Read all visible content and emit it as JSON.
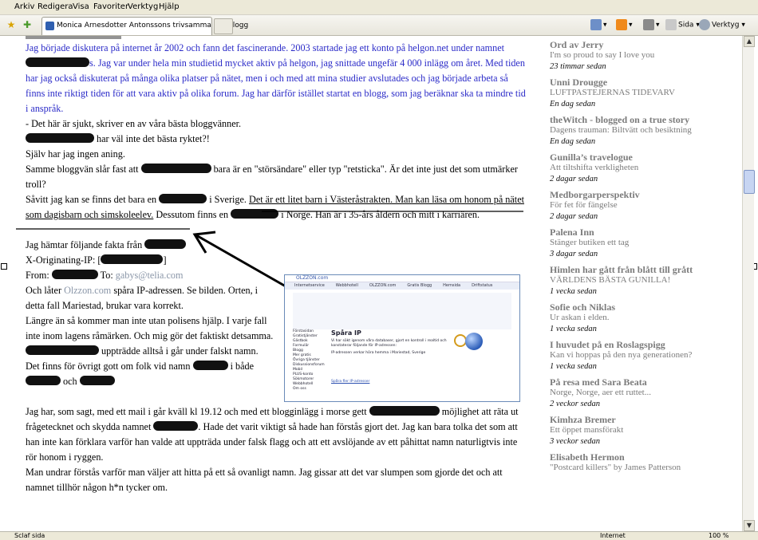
{
  "menu": [
    "Arkiv",
    "Redigera",
    "Visa",
    "Favoriter",
    "Verktyg",
    "Hjälp"
  ],
  "tab": {
    "title": "Monica Arnesdotter Antonssons trivsamma lilla blogg"
  },
  "toolbar": {
    "page_label": "Sida",
    "tools_label": "Verktyg"
  },
  "post": {
    "blue_1": "Jag började diskutera på internet år 2002 och fann det fascinerande. 2003 startade jag ett konto på helgon.net under namnet",
    "blue_2": "s. Jag var under hela min studietid mycket aktiv på helgon, jag snittade ungefär 4 000 inlägg om året. Med tiden har jag också diskuterat på många olika platser på nätet, men i och med att mina studier avslutades och jag började arbeta så finns inte riktigt tiden för att vara aktiv på olika forum. Jag har därför istället startat en blogg, som jag beräknar ska ta mindre tid i anspråk.",
    "l1": "- Det här är sjukt, skriver en av våra bästa bloggvänner.",
    "l2": "har väl inte det bästa ryktet?!",
    "l3": "Själv har jag ingen aning.",
    "l4a": "Samme bloggvän slår fast att",
    "l4b": "bara är en \"störsändare\" eller typ \"retsticka\". Är det inte just det som utmärker troll?",
    "l5a": "Såvitt jag kan se finns det bara en",
    "l5b": "i Sverige.",
    "l5c": "Det är ett litet barn i Västeråstrakten. Man kan läsa om honom på nätet som dagisbarn och simskoleelev.",
    "l5d": "Dessutom finns en",
    "l5e": "i Norge. Han är i 35-års åldern och mitt i karriären.",
    "l6": "Jag hämtar följande fakta från",
    "l7": "X-Originating-IP: [",
    "l7b": "]",
    "l8a": "From:",
    "l8b": "To:",
    "email": "gabys@telia.com",
    "l9a": "Och låter",
    "olzzon": "Olzzon.com",
    "l9b": "spåra IP-adressen. Se bilden. Orten, i detta fall Mariestad, brukar vara korrekt.",
    "l10": "Längre än så kommer man inte utan polisens hjälp. I varje fall inte inom lagens råmärken. Och mig gör det faktiskt detsamma.",
    "l11": "uppträdde alltså i går under falskt namn.",
    "l12a": "Det finns för övrigt gott om folk vid namn",
    "l12b": "i både",
    "l12c": "och",
    "l13a": "Jag har, som sagt, med ett mail i går kväll kl 19.12 och med ett blogginlägg i morse gett",
    "l13b": "möjlighet att räta ut frågetecknet och skydda namnet",
    "l13c": ". Hade det varit viktigt så hade han förstås gjort det. Jag kan bara tolka det som att han inte kan förklara varför han valde att uppträda under falsk flagg och att ett avslöjande av ett påhittat namn naturligtvis inte rör honom i ryggen.",
    "l14": "Man undrar förstås varför man väljer att hitta på ett så ovanligt namn. Jag gissar att det var slumpen som gjorde det och att namnet tillhör någon h*n tycker om."
  },
  "shot": {
    "logo": "OLZZON.com",
    "nav": [
      "Internetservice",
      "Webbhotell",
      "OLZZON.com",
      "Gratis Blogg",
      "Hemsida",
      "Driftstatus"
    ],
    "title": "Spåra IP",
    "side": [
      "Förstasidan",
      "Gratistjänster",
      "Gästbok",
      "Formulär",
      "Blogg",
      "Mer gratis",
      "Övriga tjänster",
      "Diskussionsforum",
      "Mobil",
      "PLUS-konto",
      "Sökmotorer",
      "Webbhotell",
      "Om oss"
    ],
    "text": "Vi har sökt igenom våra databaser, gjort en kontroll i realtid och konstaterar följande för IP-adressen:",
    "result": "IP-adressen verkar höra hemma i Mariestad, Sverige",
    "link": "Spåra fler IP-adresser"
  },
  "sidebar": [
    {
      "name": "Ord av Jerry",
      "post": "I'm so proud to say I love you",
      "when": "23 timmar sedan"
    },
    {
      "name": "Unni Drougge",
      "post": "LUFTPASTEJERNAS TIDEVARV",
      "when": "En dag sedan"
    },
    {
      "name": "theWitch - blogged on a true story",
      "post": "Dagens trauman: Biltvätt och besiktning",
      "when": "En dag sedan"
    },
    {
      "name": "Gunilla’s travelogue",
      "post": "Att tiltshifta verkligheten",
      "when": "2 dagar sedan"
    },
    {
      "name": "Medborgarperspektiv",
      "post": "För fet för fängelse",
      "when": "2 dagar sedan"
    },
    {
      "name": "Palena Inn",
      "post": "Stänger butiken ett tag",
      "when": "3 dagar sedan"
    },
    {
      "name": "Himlen har gått från blått till grått",
      "post": "VÄRLDENS BÄSTA GUNILLA!",
      "when": "1 vecka sedan"
    },
    {
      "name": "Sofie och Niklas",
      "post": "Ur askan i elden.",
      "when": "1 vecka sedan"
    },
    {
      "name": "I huvudet på en Roslagspigg",
      "post": "Kan vi hoppas på den nya generationen?",
      "when": "1 vecka sedan"
    },
    {
      "name": "På resa med Sara Beata",
      "post": "Norge, Norge, aer ett ruttet...",
      "when": "2 veckor sedan"
    },
    {
      "name": "Kimhza Bremer",
      "post": "Ett öppet mansförakt",
      "when": "3 veckor sedan"
    },
    {
      "name": "Elisabeth Hermon",
      "post": "\"Postcard killers\" by James Patterson",
      "when": ""
    }
  ],
  "status": {
    "left": "Sclaf sida",
    "zone": "Internet",
    "zoom": "100 %"
  }
}
